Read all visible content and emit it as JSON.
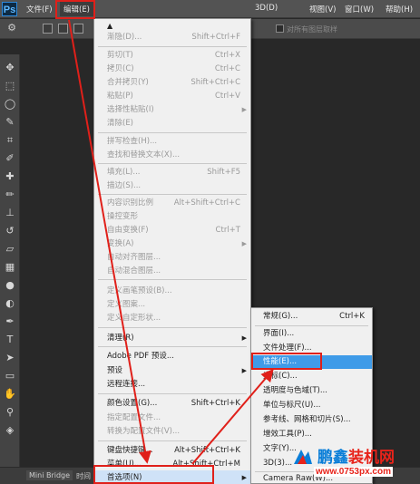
{
  "app": {
    "logo": "Ps"
  },
  "menubar": {
    "items": [
      {
        "label": "文件(F)"
      },
      {
        "label": "编辑(E)"
      },
      {
        "label": "3D(D)"
      },
      {
        "label": "视图(V)"
      },
      {
        "label": "窗口(W)"
      },
      {
        "label": "帮助(H)"
      }
    ]
  },
  "options": {
    "sample_all_layers": "对所有图层取样"
  },
  "edit_menu": {
    "items": [
      {
        "label": "渐隐(D)...",
        "shortcut": "Shift+Ctrl+F",
        "disabled": true
      },
      {
        "label": "剪切(T)",
        "shortcut": "Ctrl+X",
        "disabled": true
      },
      {
        "label": "拷贝(C)",
        "shortcut": "Ctrl+C",
        "disabled": true
      },
      {
        "label": "合并拷贝(Y)",
        "shortcut": "Shift+Ctrl+C",
        "disabled": true
      },
      {
        "label": "粘贴(P)",
        "shortcut": "Ctrl+V",
        "disabled": true
      },
      {
        "label": "选择性粘贴(I)",
        "shortcut": "",
        "disabled": true,
        "submenu": true
      },
      {
        "label": "清除(E)",
        "shortcut": "",
        "disabled": true
      },
      {
        "label": "拼写检查(H)...",
        "shortcut": "",
        "disabled": true
      },
      {
        "label": "查找和替换文本(X)...",
        "shortcut": "",
        "disabled": true
      },
      {
        "label": "填充(L)...",
        "shortcut": "Shift+F5",
        "disabled": true
      },
      {
        "label": "描边(S)...",
        "shortcut": "",
        "disabled": true
      },
      {
        "label": "内容识别比例",
        "shortcut": "Alt+Shift+Ctrl+C",
        "disabled": true
      },
      {
        "label": "操控变形",
        "shortcut": "",
        "disabled": true
      },
      {
        "label": "自由变换(F)",
        "shortcut": "Ctrl+T",
        "disabled": true
      },
      {
        "label": "变换(A)",
        "shortcut": "",
        "disabled": true,
        "submenu": true
      },
      {
        "label": "自动对齐图层...",
        "shortcut": "",
        "disabled": true
      },
      {
        "label": "自动混合图层...",
        "shortcut": "",
        "disabled": true
      },
      {
        "label": "定义画笔预设(B)...",
        "shortcut": "",
        "disabled": true
      },
      {
        "label": "定义图案...",
        "shortcut": "",
        "disabled": true
      },
      {
        "label": "定义自定形状...",
        "shortcut": "",
        "disabled": true
      },
      {
        "label": "清理(R)",
        "shortcut": "",
        "disabled": false,
        "submenu": true
      },
      {
        "label": "Adobe PDF 预设...",
        "shortcut": "",
        "disabled": false
      },
      {
        "label": "预设",
        "shortcut": "",
        "disabled": false,
        "submenu": true
      },
      {
        "label": "远程连接...",
        "shortcut": "",
        "disabled": false
      },
      {
        "label": "颜色设置(G)...",
        "shortcut": "Shift+Ctrl+K",
        "disabled": false
      },
      {
        "label": "指定配置文件...",
        "shortcut": "",
        "disabled": true
      },
      {
        "label": "转换为配置文件(V)...",
        "shortcut": "",
        "disabled": true
      },
      {
        "label": "键盘快捷键...",
        "shortcut": "Alt+Shift+Ctrl+K",
        "disabled": false
      },
      {
        "label": "菜单(U)...",
        "shortcut": "Alt+Shift+Ctrl+M",
        "disabled": false
      },
      {
        "label": "首选项(N)",
        "shortcut": "",
        "disabled": false,
        "submenu": true
      }
    ]
  },
  "prefs_submenu": {
    "items": [
      {
        "label": "常规(G)...",
        "shortcut": "Ctrl+K"
      },
      {
        "label": "界面(I)...",
        "shortcut": ""
      },
      {
        "label": "文件处理(F)...",
        "shortcut": ""
      },
      {
        "label": "性能(E)...",
        "shortcut": "",
        "selected": true
      },
      {
        "label": "光标(C)...",
        "shortcut": ""
      },
      {
        "label": "透明度与色域(T)...",
        "shortcut": ""
      },
      {
        "label": "单位与标尺(U)...",
        "shortcut": ""
      },
      {
        "label": "参考线、网格和切片(S)...",
        "shortcut": ""
      },
      {
        "label": "增效工具(P)...",
        "shortcut": ""
      },
      {
        "label": "文字(Y)...",
        "shortcut": ""
      },
      {
        "label": "3D(3)...",
        "shortcut": ""
      },
      {
        "label": "Camera Raw(W)...",
        "shortcut": ""
      }
    ]
  },
  "bottom_panel": {
    "tabs": [
      {
        "label": "Mini Bridge"
      },
      {
        "label": "时间"
      }
    ]
  },
  "watermark": {
    "title_a": "鹏鑫",
    "title_b": "装机网",
    "url": "www.0753px.com"
  },
  "colors": {
    "annotation_red": "#e0201a",
    "selection_blue": "#3f9be8",
    "menu_bg": "#f0f0f0"
  }
}
